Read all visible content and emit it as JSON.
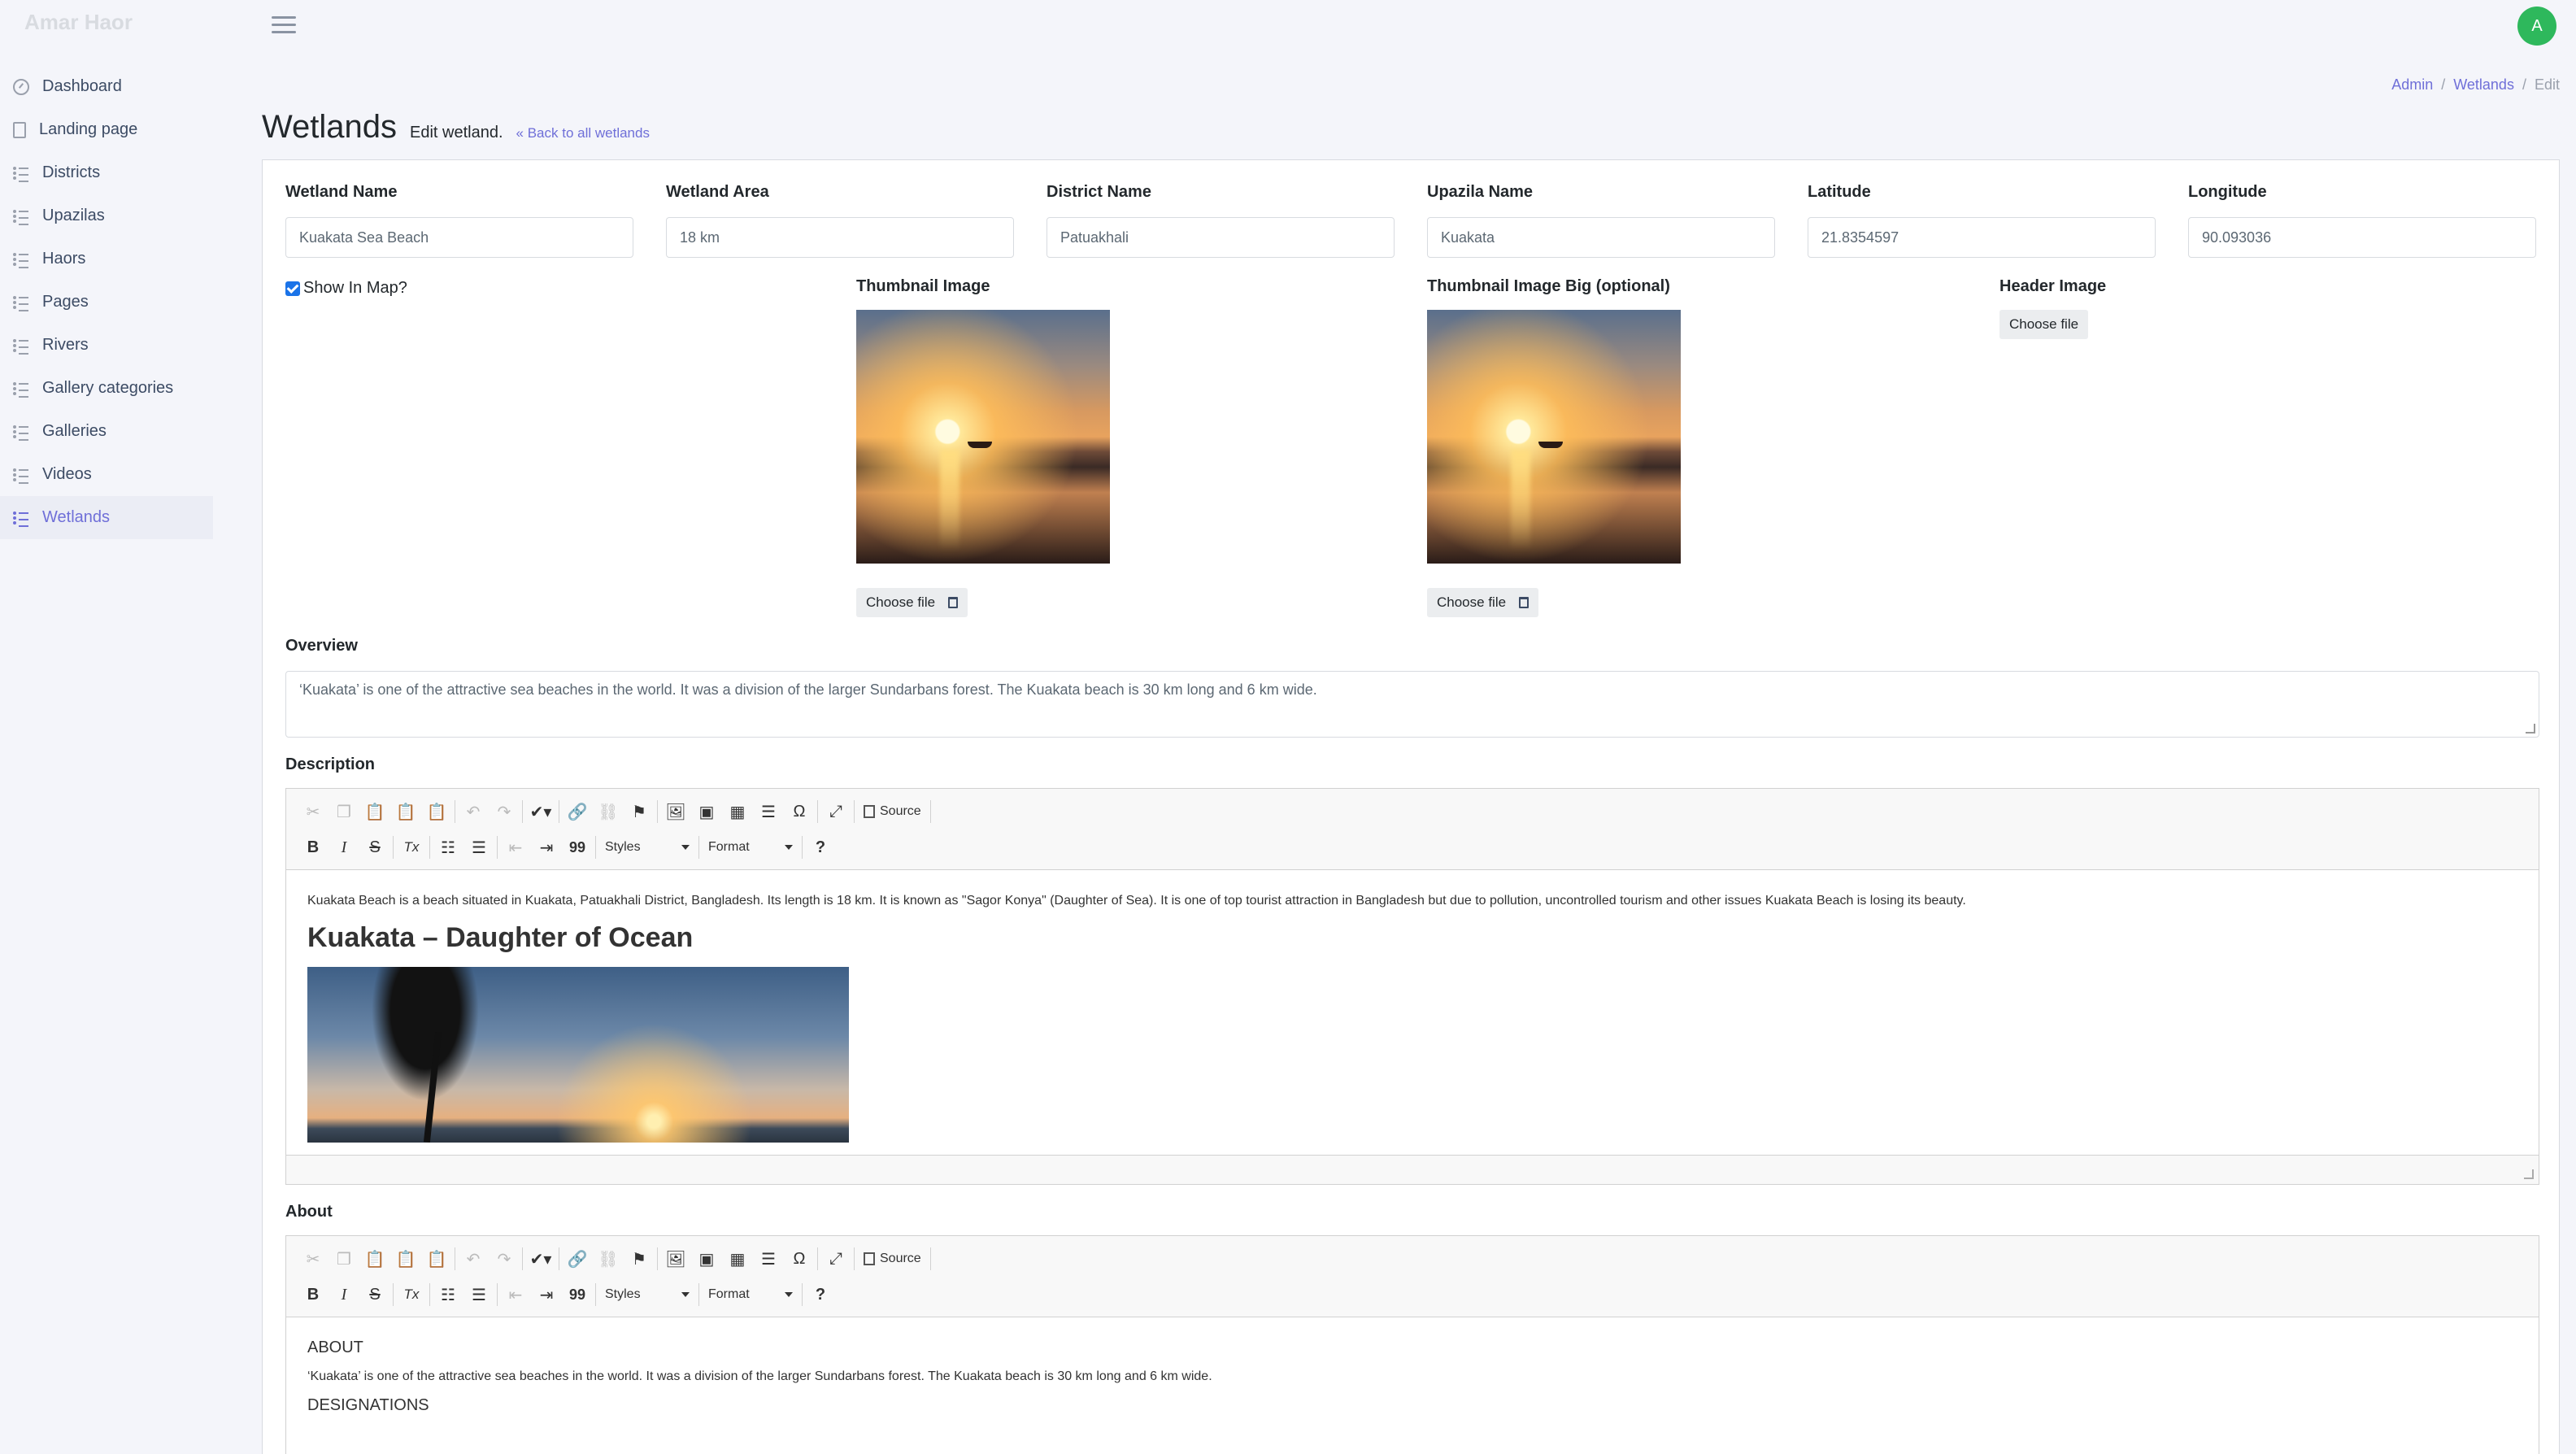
{
  "app": {
    "brand": "Amar Haor",
    "avatar_letter": "A"
  },
  "sidebar": {
    "items": [
      {
        "label": "Dashboard",
        "icon": "gauge-icon"
      },
      {
        "label": "Landing page",
        "icon": "file-icon"
      },
      {
        "label": "Districts",
        "icon": "list-icon"
      },
      {
        "label": "Upazilas",
        "icon": "list-icon"
      },
      {
        "label": "Haors",
        "icon": "list-icon"
      },
      {
        "label": "Pages",
        "icon": "list-icon"
      },
      {
        "label": "Rivers",
        "icon": "list-icon"
      },
      {
        "label": "Gallery categories",
        "icon": "list-icon"
      },
      {
        "label": "Galleries",
        "icon": "list-icon"
      },
      {
        "label": "Videos",
        "icon": "list-icon"
      },
      {
        "label": "Wetlands",
        "icon": "list-icon",
        "active": true
      }
    ]
  },
  "breadcrumb": {
    "admin": "Admin",
    "sep": "/",
    "wetlands": "Wetlands",
    "current": "Edit"
  },
  "page": {
    "title": "Wetlands",
    "subtitle": "Edit wetland.",
    "back_link": "« Back to all wetlands"
  },
  "form": {
    "wetland_name": {
      "label": "Wetland Name",
      "value": "Kuakata Sea Beach"
    },
    "wetland_area": {
      "label": "Wetland Area",
      "value": "18 km"
    },
    "district_name": {
      "label": "District Name",
      "value": "Patuakhali"
    },
    "upazila_name": {
      "label": "Upazila Name",
      "value": "Kuakata"
    },
    "latitude": {
      "label": "Latitude",
      "value": "21.8354597"
    },
    "longitude": {
      "label": "Longitude",
      "value": "90.093036"
    },
    "show_in_map": {
      "label": "Show In Map?",
      "checked": true
    },
    "thumbnail": {
      "label": "Thumbnail Image",
      "button": "Choose file"
    },
    "thumbnail_big": {
      "label": "Thumbnail Image Big (optional)",
      "button": "Choose file"
    },
    "header_image": {
      "label": "Header Image",
      "button": "Choose file"
    },
    "overview": {
      "label": "Overview",
      "value": "‘Kuakata’ is one of the attractive sea beaches in the world. It was a division of the larger Sundarbans forest. The Kuakata beach is 30 km long and 6 km wide."
    },
    "description": {
      "label": "Description",
      "paragraph": "Kuakata Beach is a beach situated in Kuakata, Patuakhali District, Bangladesh. Its length is 18 km. It is known as \"Sagor Konya\" (Daughter of Sea). It is one of top tourist attraction in Bangladesh but due to pollution, uncontrolled tourism and other issues Kuakata Beach is losing its beauty.",
      "heading": "Kuakata – Daughter of Ocean"
    },
    "about": {
      "label": "About",
      "heading1": "ABOUT",
      "paragraph": "‘Kuakata’ is one of the attractive sea beaches in the world. It was a division of the larger Sundarbans forest. The Kuakata beach is 30 km long and 6 km wide.",
      "heading2": "DESIGNATIONS"
    }
  },
  "editor_toolbar": {
    "source": "Source",
    "styles": "Styles",
    "format": "Format",
    "bold": "B",
    "italic": "I",
    "strike": "S",
    "clear": "Tx",
    "quote": "99",
    "help": "?",
    "special": "Ω"
  }
}
